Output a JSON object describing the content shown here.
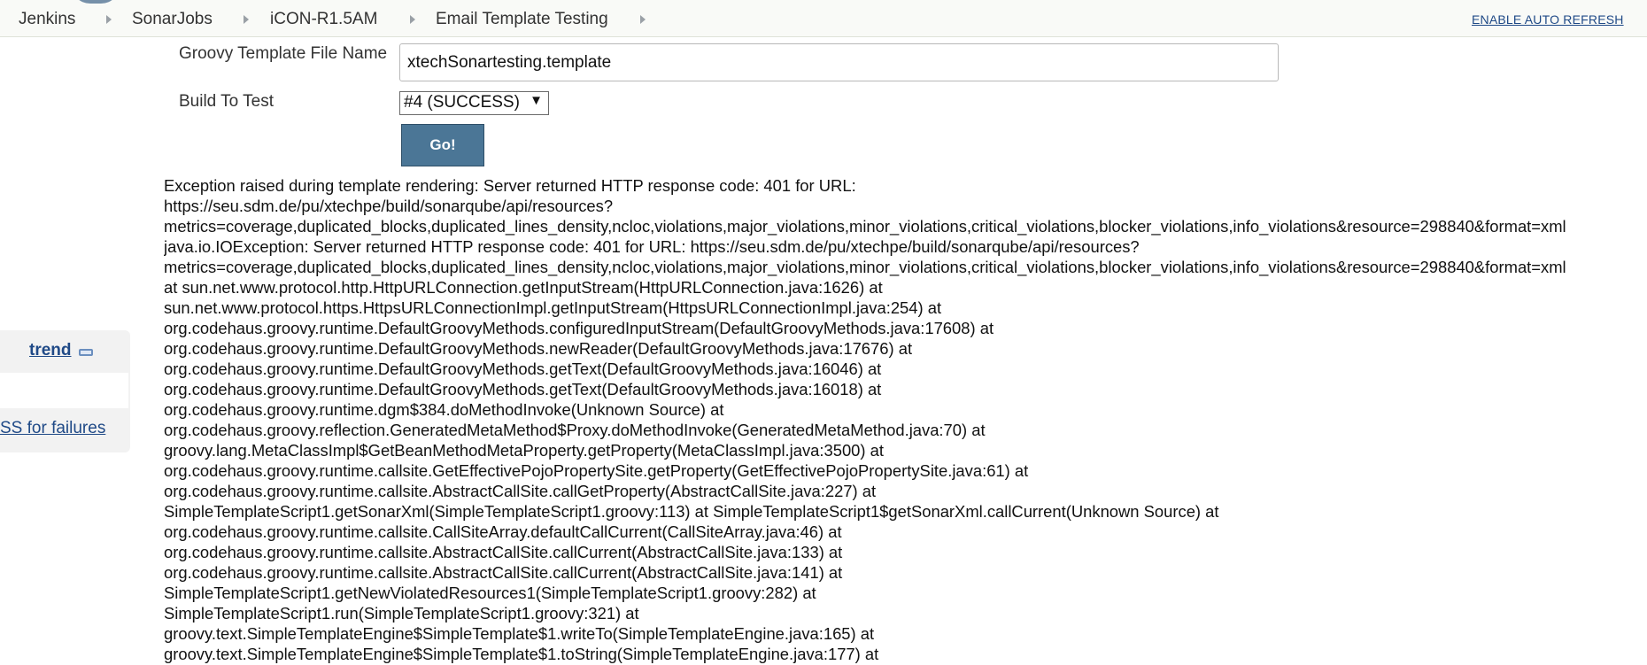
{
  "breadcrumb": {
    "items": [
      "Jenkins",
      "SonarJobs",
      "iCON-R1.5AM",
      "Email Template Testing"
    ],
    "auto_refresh": "ENABLE AUTO REFRESH"
  },
  "sidebar": {
    "trend": "trend",
    "rss_failures": "SS for failures"
  },
  "form": {
    "template_label": "Groovy Template File Name",
    "template_value": "xtechSonartesting.template",
    "build_label": "Build To Test",
    "build_selected": "#4 (SUCCESS)",
    "go_label": "Go!"
  },
  "trace_lines": [
    "Exception raised during template rendering: Server returned HTTP response code: 401 for URL:",
    "https://seu.sdm.de/pu/xtechpe/build/sonarqube/api/resources?",
    "metrics=coverage,duplicated_blocks,duplicated_lines_density,ncloc,violations,major_violations,minor_violations,critical_violations,blocker_violations,info_violations&resource=298840&format=xml",
    "java.io.IOException: Server returned HTTP response code: 401 for URL: https://seu.sdm.de/pu/xtechpe/build/sonarqube/api/resources?",
    "metrics=coverage,duplicated_blocks,duplicated_lines_density,ncloc,violations,major_violations,minor_violations,critical_violations,blocker_violations,info_violations&resource=298840&format=xml",
    "at sun.net.www.protocol.http.HttpURLConnection.getInputStream(HttpURLConnection.java:1626) at",
    "sun.net.www.protocol.https.HttpsURLConnectionImpl.getInputStream(HttpsURLConnectionImpl.java:254) at",
    "org.codehaus.groovy.runtime.DefaultGroovyMethods.configuredInputStream(DefaultGroovyMethods.java:17608) at",
    "org.codehaus.groovy.runtime.DefaultGroovyMethods.newReader(DefaultGroovyMethods.java:17676) at",
    "org.codehaus.groovy.runtime.DefaultGroovyMethods.getText(DefaultGroovyMethods.java:16046) at",
    "org.codehaus.groovy.runtime.DefaultGroovyMethods.getText(DefaultGroovyMethods.java:16018) at",
    "org.codehaus.groovy.runtime.dgm$384.doMethodInvoke(Unknown Source) at",
    "org.codehaus.groovy.reflection.GeneratedMetaMethod$Proxy.doMethodInvoke(GeneratedMetaMethod.java:70) at",
    "groovy.lang.MetaClassImpl$GetBeanMethodMetaProperty.getProperty(MetaClassImpl.java:3500) at",
    "org.codehaus.groovy.runtime.callsite.GetEffectivePojoPropertySite.getProperty(GetEffectivePojoPropertySite.java:61) at",
    "org.codehaus.groovy.runtime.callsite.AbstractCallSite.callGetProperty(AbstractCallSite.java:227) at",
    "SimpleTemplateScript1.getSonarXml(SimpleTemplateScript1.groovy:113) at SimpleTemplateScript1$getSonarXml.callCurrent(Unknown Source) at",
    "org.codehaus.groovy.runtime.callsite.CallSiteArray.defaultCallCurrent(CallSiteArray.java:46) at",
    "org.codehaus.groovy.runtime.callsite.AbstractCallSite.callCurrent(AbstractCallSite.java:133) at",
    "org.codehaus.groovy.runtime.callsite.AbstractCallSite.callCurrent(AbstractCallSite.java:141) at",
    "SimpleTemplateScript1.getNewViolatedResources1(SimpleTemplateScript1.groovy:282) at",
    "SimpleTemplateScript1.run(SimpleTemplateScript1.groovy:321) at",
    "groovy.text.SimpleTemplateEngine$SimpleTemplate$1.writeTo(SimpleTemplateEngine.java:165) at",
    "groovy.text.SimpleTemplateEngine$SimpleTemplate$1.toString(SimpleTemplateEngine.java:177) at"
  ]
}
